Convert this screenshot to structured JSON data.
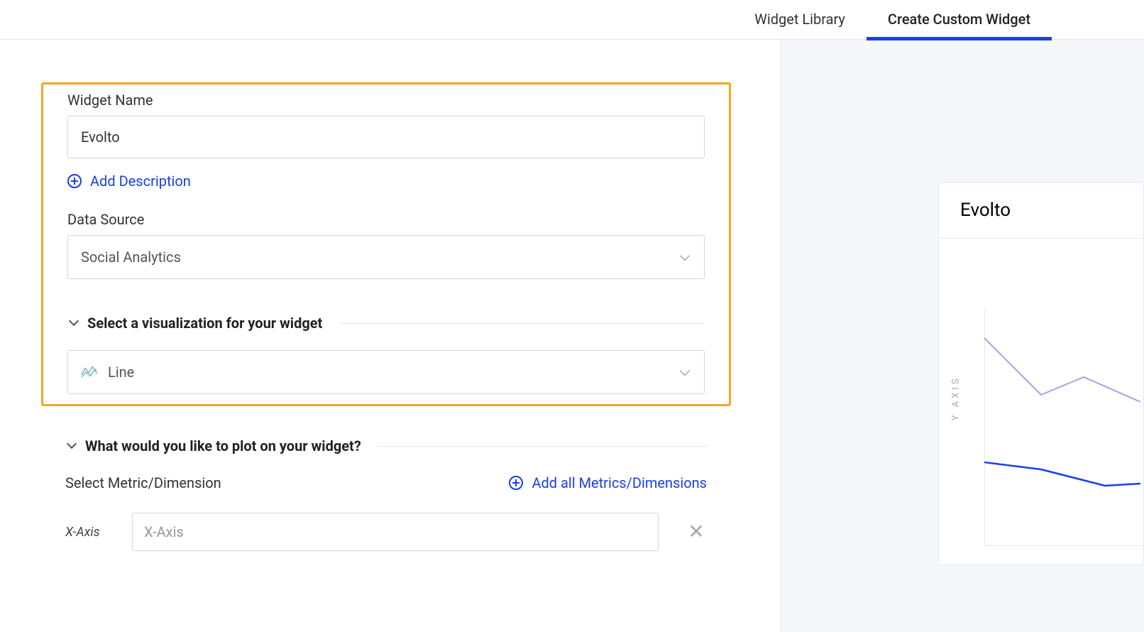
{
  "tabs": {
    "library": "Widget Library",
    "create": "Create Custom Widget"
  },
  "form": {
    "widget_name_label": "Widget Name",
    "widget_name_value": "Evolto",
    "add_description": "Add Description",
    "data_source_label": "Data Source",
    "data_source_value": "Social Analytics",
    "viz_section_title": "Select a visualization for your widget",
    "viz_value": "Line",
    "plot_section_title": "What would you like to plot on your widget?",
    "select_metric_label": "Select Metric/Dimension",
    "add_all_metrics": "Add all Metrics/Dimensions",
    "x_axis_label": "X-Axis",
    "x_axis_placeholder": "X-Axis"
  },
  "preview": {
    "title": "Evolto",
    "y_axis_label": "Y AXIS"
  }
}
